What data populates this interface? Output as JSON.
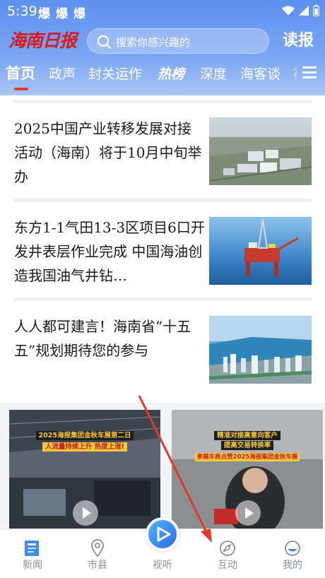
{
  "status_bar": {
    "time": "5:39",
    "notif_icon": "爆"
  },
  "header": {
    "logo_text": "海南日报",
    "search_placeholder": "搜索你感兴趣的",
    "reader_label": "读报",
    "accent_color": "#5d8ff0",
    "logo_color": "#d91a1a"
  },
  "tabs": [
    {
      "label": "首页",
      "active": true
    },
    {
      "label": "政声"
    },
    {
      "label": "封关运作"
    },
    {
      "label": "热榜"
    },
    {
      "label": "深度"
    },
    {
      "label": "海客谈"
    },
    {
      "label": "初"
    }
  ],
  "articles": [
    {
      "title": "2025中国产业转移发展对接活动（海南）将于10月中旬举办",
      "image": "industrial-park-aerial"
    },
    {
      "title": "东方1-1气田13-3区项目6口开发井表层作业完成 中国海油创造我国油气井钻…",
      "image": "offshore-oil-platform"
    },
    {
      "title": "人人都可建言！海南省“十五五”规划期待您的参与",
      "image": "coastal-city-skyline"
    }
  ],
  "videos": [
    {
      "caption_line1": "2025海报集团金秋车展第二日",
      "caption_line2": "人流量持续上升 热度上涨!"
    },
    {
      "caption_line1": "精准对接高意向客户",
      "caption_line2": "提高交易转换率",
      "caption_line3": "参展车商点赞2025海报集团金秋车展"
    }
  ],
  "bottom_nav": [
    {
      "label": "新闻",
      "icon": "news-icon"
    },
    {
      "label": "市县",
      "icon": "location-pin-icon"
    },
    {
      "label": "视听",
      "icon": "play-icon"
    },
    {
      "label": "互动",
      "icon": "compass-icon"
    },
    {
      "label": "我的",
      "icon": "profile-icon"
    }
  ]
}
